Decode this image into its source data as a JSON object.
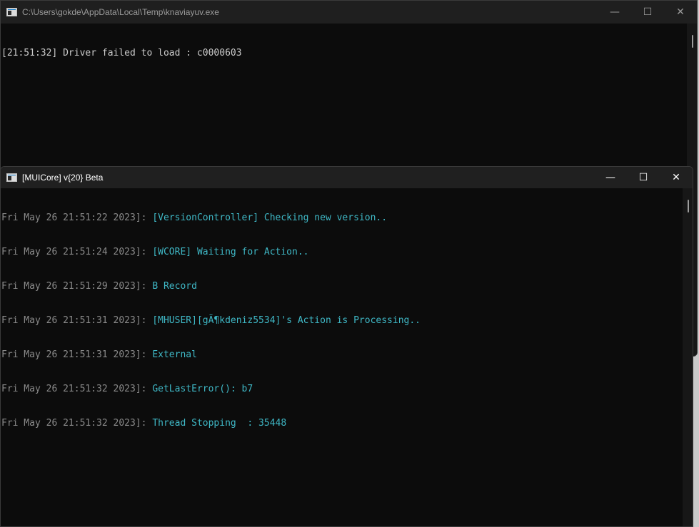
{
  "window_back": {
    "title": "C:\\Users\\gokde\\AppData\\Local\\Temp\\knaviayuv.exe",
    "controls": {
      "minimize": "—",
      "maximize": "☐",
      "close": "✕"
    },
    "lines": [
      "[21:51:32] Driver failed to load : c0000603"
    ]
  },
  "window_front": {
    "title": "[MUICore] v{20} Beta",
    "controls": {
      "minimize": "—",
      "maximize": "☐",
      "close": "✕"
    },
    "log": [
      {
        "ts": "Fri May 26 21:51:22 2023]: ",
        "msg": "[VersionController] Checking new version.."
      },
      {
        "ts": "Fri May 26 21:51:24 2023]: ",
        "msg": "[WCORE] Waiting for Action.."
      },
      {
        "ts": "Fri May 26 21:51:29 2023]: ",
        "msg": "B Record"
      },
      {
        "ts": "Fri May 26 21:51:31 2023]: ",
        "msg": "[MHUSER][gÃ¶kdeniz5534]'s Action is Processing.."
      },
      {
        "ts": "Fri May 26 21:51:31 2023]: ",
        "msg": "External"
      },
      {
        "ts": "Fri May 26 21:51:32 2023]: ",
        "msg": "GetLastError(): b7"
      },
      {
        "ts": "Fri May 26 21:51:32 2023]: ",
        "msg": "Thread Stopping  : 35448"
      }
    ]
  },
  "colors": {
    "console_bg": "#0c0c0c",
    "timestamp": "#8a8a8a",
    "message": "#3fb8c6",
    "plain_text": "#cccccc"
  }
}
